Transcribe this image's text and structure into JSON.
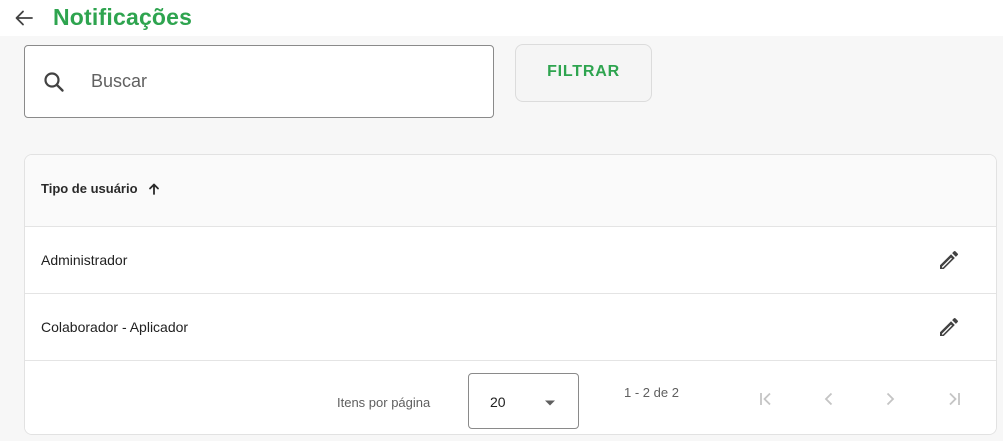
{
  "header": {
    "title": "Notificações",
    "back_icon": "arrow-left-icon"
  },
  "search": {
    "placeholder": "Buscar",
    "value": "",
    "icon": "search-icon"
  },
  "toolbar": {
    "filter_label": "FILTRAR"
  },
  "table": {
    "columns": [
      {
        "label": "Tipo de usuário",
        "sort": "ascending",
        "sort_icon": "arrow-up-icon"
      }
    ],
    "rows": [
      {
        "tipo": "Administrador",
        "action_icon": "pencil-icon"
      },
      {
        "tipo": "Colaborador - Aplicador",
        "action_icon": "pencil-icon"
      }
    ]
  },
  "paginator": {
    "items_per_page_label": "Itens por página",
    "page_size": "20",
    "range_label": "1 - 2 de 2",
    "first_icon": "first-page-icon",
    "prev_icon": "chevron-left-icon",
    "next_icon": "chevron-right-icon",
    "last_icon": "last-page-icon"
  },
  "colors": {
    "accent": "#2ea44f",
    "background": "#f7f7f7",
    "surface": "#ffffff",
    "disabled_icon": "#c4c4c4"
  }
}
